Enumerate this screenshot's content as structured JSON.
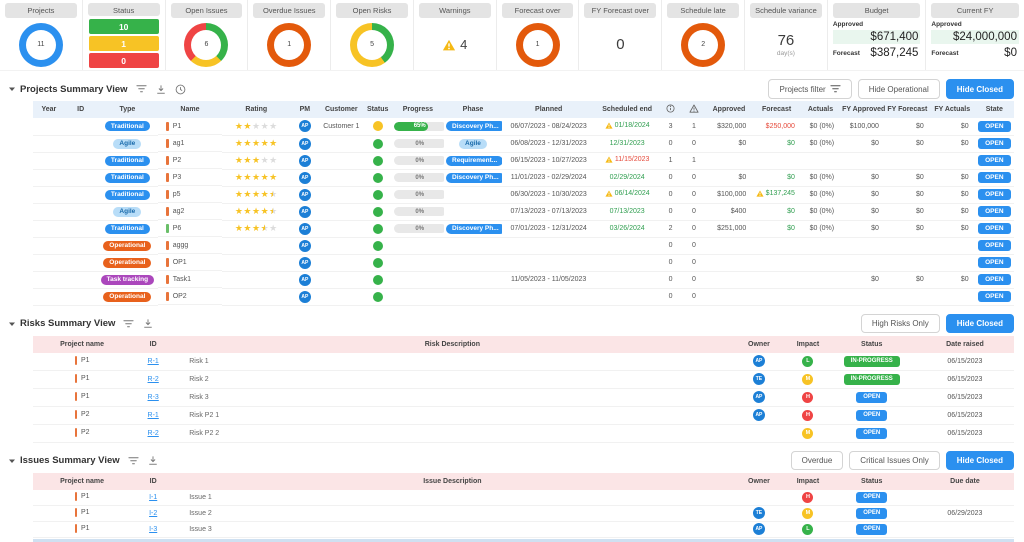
{
  "colors": {
    "accent_blue": "#2b90ef",
    "green": "#36b24a",
    "yellow": "#f7c325",
    "red": "#ef4444",
    "orange": "#e8611c",
    "donut_orange": "#e3590b",
    "purple": "#ab47bc",
    "light_blue_bg": "#b8ddf8",
    "light_blue_text": "#1769aa",
    "pink_header": "#fbe5e6",
    "blue_header": "#e9f1fa",
    "money_green_bg": "#e9f6ee",
    "text_green": "#2f9e4f",
    "text_red": "#e5493a",
    "warn_yellow": "#f5b914",
    "bar_orange": "#e8743b",
    "bar_green": "#6abf69",
    "avatar_blue": "#1c7fd6"
  },
  "kpis": {
    "cards": [
      {
        "label": "Projects",
        "kind": "donut",
        "value": "11",
        "segments": [
          {
            "color": "#2b90ef",
            "pct": 100
          }
        ]
      },
      {
        "label": "Status",
        "kind": "bars",
        "bars": [
          {
            "value": "10",
            "color": "#36b24a"
          },
          {
            "value": "1",
            "color": "#f7c325"
          },
          {
            "value": "0",
            "color": "#ef4444"
          }
        ]
      },
      {
        "label": "Open Issues",
        "kind": "donut",
        "value": "6",
        "segments": [
          {
            "color": "#36b24a",
            "pct": 38
          },
          {
            "color": "#f7c325",
            "pct": 24
          },
          {
            "color": "#ef4444",
            "pct": 38
          }
        ]
      },
      {
        "label": "Overdue Issues",
        "kind": "donut",
        "value": "1",
        "segments": [
          {
            "color": "#e3590b",
            "pct": 100
          }
        ]
      },
      {
        "label": "Open Risks",
        "kind": "donut",
        "value": "5",
        "segments": [
          {
            "color": "#36b24a",
            "pct": 40
          },
          {
            "color": "#f7c325",
            "pct": 60
          }
        ]
      },
      {
        "label": "Warnings",
        "kind": "warn",
        "value": "4"
      },
      {
        "label": "Forecast over",
        "kind": "donut",
        "value": "1",
        "segments": [
          {
            "color": "#e3590b",
            "pct": 100
          }
        ]
      },
      {
        "label": "FY Forecast over",
        "kind": "number",
        "value": "0"
      },
      {
        "label": "Schedule late",
        "kind": "donut",
        "value": "2",
        "segments": [
          {
            "color": "#e3590b",
            "pct": 100
          }
        ]
      },
      {
        "label": "Schedule variance",
        "kind": "number",
        "value": "76",
        "sub": "day(s)"
      },
      {
        "label": "Budget",
        "kind": "money",
        "rows": [
          {
            "label": "Approved",
            "value": "$671,400",
            "highlight": true
          },
          {
            "label": "Forecast",
            "value": "$387,245",
            "highlight": false
          }
        ]
      },
      {
        "label": "Current FY",
        "kind": "money",
        "rows": [
          {
            "label": "Approved",
            "value": "$24,000,000",
            "highlight": true
          },
          {
            "label": "Forecast",
            "value": "$0",
            "highlight": false
          }
        ]
      }
    ]
  },
  "projects": {
    "title": "Projects Summary View",
    "icons": [
      "filter",
      "download",
      "clock"
    ],
    "buttons": [
      {
        "label": "Projects filter",
        "icon": "filter",
        "variant": "outline"
      },
      {
        "label": "Hide Operational",
        "variant": "outline"
      },
      {
        "label": "Hide Closed",
        "variant": "primary"
      }
    ],
    "columns": [
      "Year",
      "ID",
      "Type",
      "Name",
      "Rating",
      "PM",
      "Customer",
      "Status",
      "Progress",
      "Phase",
      "Planned",
      "Scheduled end",
      "info-icon",
      "warning-icon",
      "Approved",
      "Forecast",
      "Actuals",
      "FY Approved",
      "FY Forecast",
      "FY Actuals",
      "State"
    ],
    "rows": [
      {
        "year": "",
        "id": "",
        "type": "Traditional",
        "bar": "orange",
        "name": "P1",
        "rating": 2,
        "pm": "AP",
        "customer": "Customer 1",
        "status": "yellow",
        "progress": "65%",
        "phase": "Discovery Ph...",
        "planned": "06/07/2023 - 08/24/2023",
        "sched": "01/18/2024",
        "sched_color": "green",
        "sched_warn": true,
        "info": "3",
        "warn": "1",
        "approved": "$320,000",
        "forecast": "$250,000",
        "forecast_color": "red",
        "actuals": "$0 (0%)",
        "fy_approved": "$100,000",
        "fy_forecast": "$0",
        "fy_actuals": "$0",
        "state": "OPEN"
      },
      {
        "type": "Agile",
        "bar": "orange",
        "name": "ag1",
        "rating": 5,
        "pm": "AP",
        "status": "green",
        "progress": "0%",
        "phase": "Agile",
        "planned": "06/08/2023 - 12/31/2023",
        "sched": "12/31/2023",
        "sched_color": "green",
        "info": "0",
        "warn": "0",
        "approved": "$0",
        "forecast": "$0",
        "forecast_color": "green",
        "actuals": "$0 (0%)",
        "fy_approved": "$0",
        "fy_forecast": "$0",
        "fy_actuals": "$0",
        "state": "OPEN"
      },
      {
        "type": "Traditional",
        "bar": "orange",
        "name": "P2",
        "rating": 3,
        "pm": "AP",
        "status": "green",
        "progress": "0%",
        "phase": "Requirement...",
        "planned": "06/15/2023 - 10/27/2023",
        "sched": "11/15/2023",
        "sched_color": "red",
        "sched_warn": true,
        "info": "1",
        "warn": "1",
        "state": "OPEN"
      },
      {
        "type": "Traditional",
        "bar": "orange",
        "name": "P3",
        "rating": 5,
        "pm": "AP",
        "status": "green",
        "progress": "0%",
        "phase": "Discovery Ph...",
        "planned": "11/01/2023 - 02/29/2024",
        "sched": "02/29/2024",
        "sched_color": "green",
        "info": "0",
        "warn": "0",
        "approved": "$0",
        "forecast": "$0",
        "forecast_color": "green",
        "actuals": "$0 (0%)",
        "fy_approved": "$0",
        "fy_forecast": "$0",
        "fy_actuals": "$0",
        "state": "OPEN"
      },
      {
        "type": "Traditional",
        "bar": "orange",
        "name": "p5",
        "rating": 4.5,
        "pm": "AP",
        "status": "green",
        "progress": "0%",
        "planned": "06/30/2023 - 10/30/2023",
        "sched": "06/14/2024",
        "sched_color": "green",
        "sched_warn": true,
        "info": "0",
        "warn": "0",
        "approved": "$100,000",
        "forecast": "$137,245",
        "forecast_color": "green",
        "forecast_warn": true,
        "actuals": "$0 (0%)",
        "fy_approved": "$0",
        "fy_forecast": "$0",
        "fy_actuals": "$0",
        "state": "OPEN"
      },
      {
        "type": "Agile",
        "bar": "orange",
        "name": "ag2",
        "rating": 4.5,
        "pm": "AP",
        "status": "green",
        "progress": "0%",
        "planned": "07/13/2023 - 07/13/2023",
        "sched": "07/13/2023",
        "sched_color": "green",
        "info": "0",
        "warn": "0",
        "approved": "$400",
        "forecast": "$0",
        "forecast_color": "green",
        "actuals": "$0 (0%)",
        "fy_approved": "$0",
        "fy_forecast": "$0",
        "fy_actuals": "$0",
        "state": "OPEN"
      },
      {
        "type": "Traditional",
        "bar": "green",
        "name": "P6",
        "rating": 3.5,
        "pm": "AP",
        "status": "green",
        "progress": "0%",
        "phase": "Discovery Ph...",
        "planned": "07/01/2023 - 12/31/2024",
        "sched": "03/26/2024",
        "sched_color": "green",
        "info": "2",
        "warn": "0",
        "approved": "$251,000",
        "forecast": "$0",
        "forecast_color": "green",
        "actuals": "$0 (0%)",
        "fy_approved": "$0",
        "fy_forecast": "$0",
        "fy_actuals": "$0",
        "state": "OPEN"
      },
      {
        "type": "Operational",
        "bar": "orange",
        "name": "aggg",
        "pm": "AP",
        "status": "green",
        "info": "0",
        "warn": "0",
        "state": "OPEN"
      },
      {
        "type": "Operational",
        "bar": "orange",
        "name": "OP1",
        "pm": "AP",
        "status": "green",
        "info": "0",
        "warn": "0",
        "state": "OPEN"
      },
      {
        "type": "Task tracking",
        "bar": "orange",
        "name": "Task1",
        "pm": "AP",
        "status": "green",
        "planned": "11/05/2023 - 11/05/2023",
        "info": "0",
        "warn": "0",
        "fy_approved": "$0",
        "fy_forecast": "$0",
        "fy_actuals": "$0",
        "state": "OPEN"
      },
      {
        "type": "Operational",
        "bar": "orange",
        "name": "OP2",
        "pm": "AP",
        "status": "green",
        "info": "0",
        "warn": "0",
        "state": "OPEN"
      }
    ]
  },
  "risks": {
    "title": "Risks Summary View",
    "icons": [
      "filter",
      "download"
    ],
    "buttons": [
      {
        "label": "High Risks Only",
        "variant": "outline"
      },
      {
        "label": "Hide Closed",
        "variant": "primary"
      }
    ],
    "columns": [
      "Project name",
      "ID",
      "Risk Description",
      "Owner",
      "Impact",
      "Status",
      "Date raised"
    ],
    "rows": [
      {
        "project": "P1",
        "id": "R-1",
        "desc": "Risk 1",
        "owner": "AP",
        "impact": "L",
        "status": "IN-PROGRESS",
        "date": "06/15/2023"
      },
      {
        "project": "P1",
        "id": "R-2",
        "desc": "Risk 2",
        "owner": "TE",
        "impact": "M",
        "status": "IN-PROGRESS",
        "date": "06/15/2023"
      },
      {
        "project": "P1",
        "id": "R-3",
        "desc": "Risk 3",
        "owner": "AP",
        "impact": "H",
        "status": "OPEN",
        "date": "06/15/2023"
      },
      {
        "project": "P2",
        "id": "R-1",
        "desc": "Risk P2 1",
        "owner": "AP",
        "impact": "H",
        "status": "OPEN",
        "date": "06/15/2023"
      },
      {
        "project": "P2",
        "id": "R-2",
        "desc": "Risk P2 2",
        "owner": "",
        "impact": "M",
        "status": "OPEN",
        "date": "06/15/2023"
      }
    ]
  },
  "issues": {
    "title": "Issues Summary View",
    "icons": [
      "filter",
      "download"
    ],
    "buttons": [
      {
        "label": "Overdue",
        "variant": "outline"
      },
      {
        "label": "Critical Issues Only",
        "variant": "outline"
      },
      {
        "label": "Hide Closed",
        "variant": "primary"
      }
    ],
    "columns": [
      "Project name",
      "ID",
      "Issue Description",
      "Owner",
      "Impact",
      "Status",
      "Due date"
    ],
    "rows": [
      {
        "project": "P1",
        "id": "I-1",
        "desc": "Issue 1",
        "owner": "",
        "impact": "H",
        "status": "OPEN",
        "date": ""
      },
      {
        "project": "P1",
        "id": "I-2",
        "desc": "Issue 2",
        "owner": "TE",
        "impact": "M",
        "status": "OPEN",
        "date": "06/29/2023"
      },
      {
        "project": "P1",
        "id": "I-3",
        "desc": "Issue 3",
        "owner": "AP",
        "impact": "L",
        "status": "OPEN",
        "date": ""
      }
    ]
  }
}
